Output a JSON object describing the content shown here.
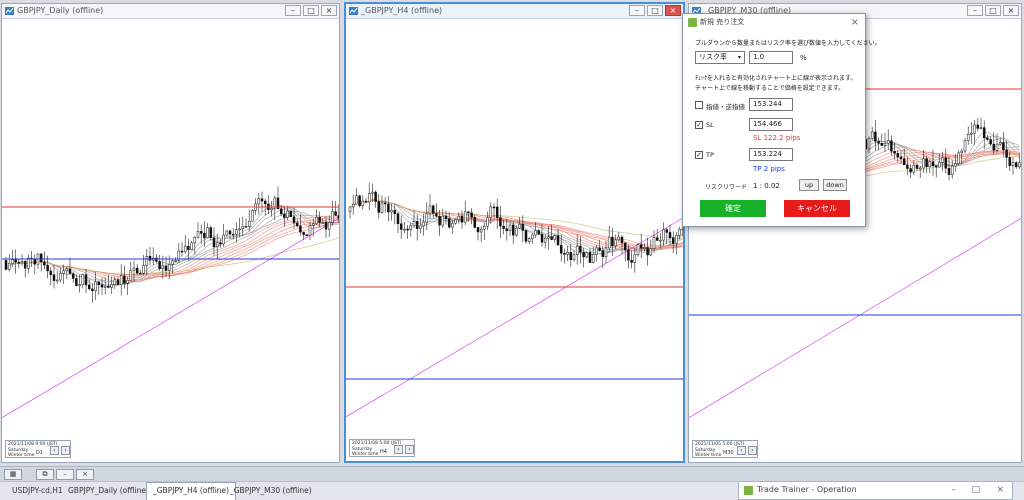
{
  "windows": [
    {
      "title": "GBPJPY_Daily (offline)",
      "info_date": "2021/11/08 9:00 (JST)",
      "info_day": "Saturday",
      "info_season": "Winter time",
      "timeframe": "D1"
    },
    {
      "title": "_GBPJPY_H4 (offline)",
      "info_date": "2021/11/08 5:00 (JST)",
      "info_day": "Saturday",
      "info_season": "Winter time",
      "timeframe": "H4"
    },
    {
      "title": "_GBPJPY_M30 (offline)",
      "info_date": "2021/11/05 5:00 (JST)",
      "info_day": "Saturday",
      "info_season": "Winter time",
      "timeframe": "M30"
    }
  ],
  "dialog": {
    "title": "新規 売り注文",
    "instruction": "プルダウンから数量またはリスク率を選び数値を入力してください。",
    "mode_select": "リスク率",
    "risk_value": "1.0",
    "risk_unit": "%",
    "line_info_1": "ﾁｪｯｸを入れると有効化されチャート上に線が表示されます。",
    "line_info_2": "チャート上で線を移動することで価格を設定できます。",
    "entry_label": "指値・逆指値",
    "entry_value": "153.244",
    "entry_checked": false,
    "sl_label": "SL",
    "sl_value": "154.466",
    "sl_checked": true,
    "sl_pips": "SL 122.2 pips",
    "tp_label": "TP",
    "tp_value": "153.224",
    "tp_checked": true,
    "tp_pips": "TP 2 pips",
    "reward_label": "リスクリワード",
    "reward_value": "1 : 0.02",
    "up_label": "up",
    "down_label": "down",
    "confirm_label": "確定",
    "cancel_label": "キャンセル",
    "colors": {
      "confirm": "#17b22a",
      "cancel": "#e81b1b",
      "sl": "#e53935",
      "tp": "#1f3fe0"
    }
  },
  "tabs": [
    {
      "label": "USDJPY-cd,H1"
    },
    {
      "label": "GBPJPY_Daily (offline)"
    },
    {
      "label": "_GBPJPY_H4 (offline)"
    },
    {
      "label": "_GBPJPY_M30 (offline)"
    }
  ],
  "trainer": {
    "title": "Trade Trainer - Operation"
  },
  "icons": {
    "minimize": "minimize-icon",
    "maximize": "maximize-icon",
    "close": "close-icon"
  }
}
